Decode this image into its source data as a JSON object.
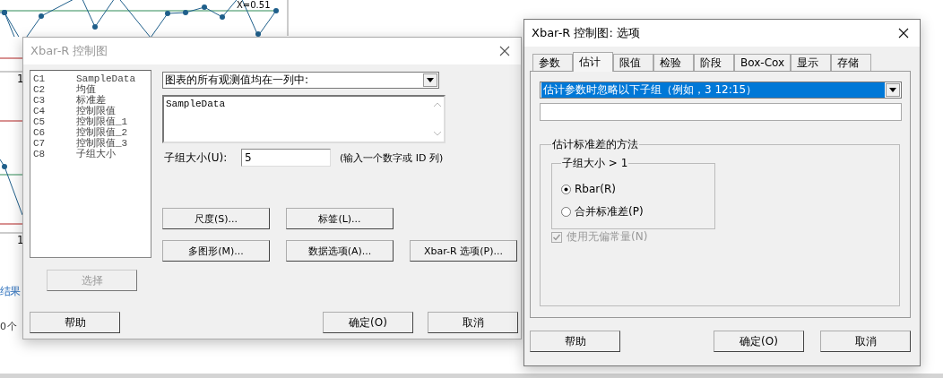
{
  "background_page": {
    "chart_label": "X̄=0.51",
    "axis_ticks": [
      "1",
      "1"
    ],
    "link_text": "结果",
    "count_text": "0 个"
  },
  "main_dialog": {
    "title": "Xbar-R 控制图",
    "active": false,
    "columns": [
      {
        "id": "C1",
        "name": "SampleData"
      },
      {
        "id": "C2",
        "name": "均值"
      },
      {
        "id": "C3",
        "name": "标准差"
      },
      {
        "id": "C4",
        "name": "控制限值"
      },
      {
        "id": "C5",
        "name": "控制限值_1"
      },
      {
        "id": "C6",
        "name": "控制限值_2"
      },
      {
        "id": "C7",
        "name": "控制限值_3"
      },
      {
        "id": "C8",
        "name": "子组大小"
      }
    ],
    "select_button": {
      "label": "选择",
      "disabled": true
    },
    "data_arrangement": "图表的所有观测值均在一列中:",
    "variables": "SampleData",
    "subgroup_label": "子组大小(U):",
    "subgroup_value": "5",
    "subgroup_hint": "(输入一个数字或 ID 列)",
    "option_buttons": [
      [
        "尺度(S)...",
        "标签(L)..."
      ],
      [
        "多图形(M)...",
        "数据选项(A)...",
        "Xbar-R 选项(P)..."
      ]
    ],
    "help_button": "帮助",
    "ok_button": "确定(O)",
    "cancel_button": "取消"
  },
  "options_dialog": {
    "title": "Xbar-R 控制图: 选项",
    "active": true,
    "tabs": [
      {
        "label": "参数",
        "selected": false
      },
      {
        "label": "估计",
        "selected": true
      },
      {
        "label": "限值",
        "selected": false
      },
      {
        "label": "检验",
        "selected": false
      },
      {
        "label": "阶段",
        "selected": false
      },
      {
        "label": "Box-Cox",
        "selected": false
      },
      {
        "label": "显示",
        "selected": false
      },
      {
        "label": "存储",
        "selected": false
      }
    ],
    "omit_option": {
      "value": "估计参数时忽略以下子组（例如，3 12:15）",
      "highlighted": true
    },
    "method_group": "估计标准差的方法",
    "subgroup_group": "子组大小 > 1",
    "methods": [
      {
        "label": "Rbar(R)",
        "selected": true
      },
      {
        "label": "合并标准差(P)",
        "selected": false
      }
    ],
    "unbiasing": {
      "label": "使用无偏常量(N)",
      "checked": true,
      "disabled": true
    },
    "help_button": "帮助",
    "ok_button": "确定(O)",
    "cancel_button": "取消"
  }
}
